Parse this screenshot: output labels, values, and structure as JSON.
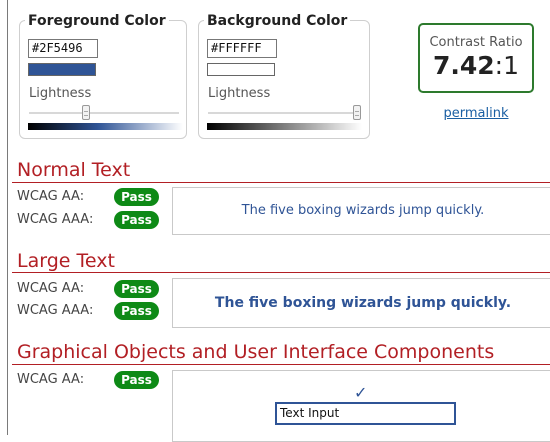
{
  "foreground": {
    "legend": "Foreground Color",
    "hex": "#2F5496",
    "lightness_label": "Lightness",
    "lightness_value": 0.42,
    "swatch_color": "#2F5496"
  },
  "background": {
    "legend": "Background Color",
    "hex": "#FFFFFF",
    "lightness_label": "Lightness",
    "lightness_value": 1.0,
    "swatch_color": "#FFFFFF"
  },
  "contrast": {
    "label": "Contrast Ratio",
    "value_main": "7.42",
    "value_suffix": ":1",
    "border_color": "#2D7A2D",
    "permalink": "permalink"
  },
  "sections": {
    "normal": {
      "title": "Normal Text",
      "aa_label": "WCAG AA:",
      "aa_result": "Pass",
      "aaa_label": "WCAG AAA:",
      "aaa_result": "Pass",
      "sample": "The five boxing wizards jump quickly."
    },
    "large": {
      "title": "Large Text",
      "aa_label": "WCAG AA:",
      "aa_result": "Pass",
      "aaa_label": "WCAG AAA:",
      "aaa_result": "Pass",
      "sample": "The five boxing wizards jump quickly."
    },
    "graphical": {
      "title": "Graphical Objects and User Interface Components",
      "aa_label": "WCAG AA:",
      "aa_result": "Pass",
      "check_icon": "✓",
      "text_input": "Text Input"
    }
  },
  "colors": {
    "pass_badge": "#0E8A16",
    "section_title": "#B21F24",
    "link": "#1A5FA3"
  }
}
